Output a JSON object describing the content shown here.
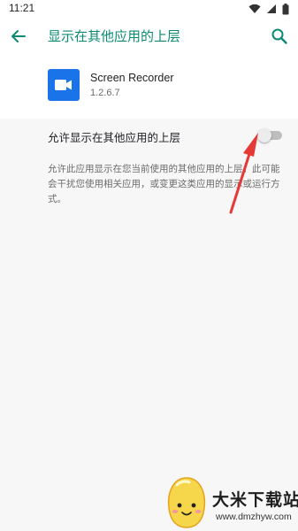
{
  "status_bar": {
    "time": "11:21"
  },
  "app_bar": {
    "title": "显示在其他应用的上层",
    "back_icon": "arrow-back-icon",
    "search_icon": "search-icon",
    "title_color": "#0b8a73"
  },
  "app": {
    "name": "Screen Recorder",
    "version": "1.2.6.7",
    "icon": "videocam-icon",
    "icon_color": "#1a73e8"
  },
  "setting": {
    "label": "允许显示在其他应用的上层",
    "enabled": false,
    "description": "允许此应用显示在您当前使用的其他应用的上层。此可能会干扰您使用相关应用，或变更这类应用的显示或运行方式。"
  },
  "annotation": {
    "type": "red-arrow",
    "color": "#e53935"
  },
  "watermark": {
    "name": "大米下载站",
    "url": "www.dmzhyw.com"
  }
}
